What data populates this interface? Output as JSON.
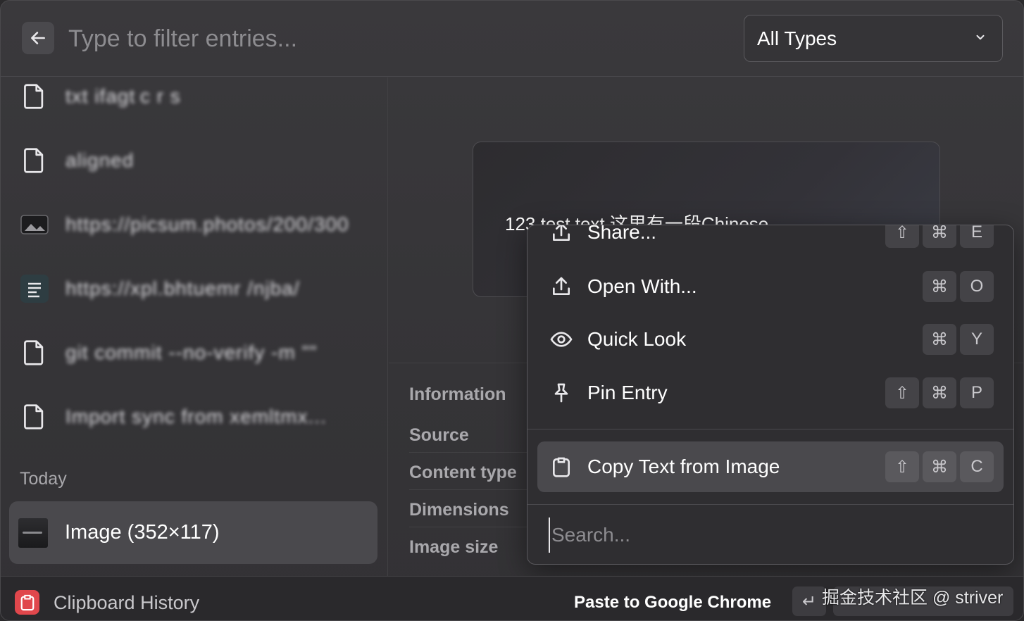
{
  "search": {
    "placeholder": "Type to filter entries..."
  },
  "type_filter": {
    "selected": "All Types"
  },
  "history": {
    "items": [
      {
        "icon": "document-icon",
        "label": "txt ifagt c r s"
      },
      {
        "icon": "document-icon",
        "label": "aligned"
      },
      {
        "icon": "image-icon",
        "label": "https://picsum.photos/200/300"
      },
      {
        "icon": "link-icon",
        "label": "https://xpl.bhtuemr /njba/"
      },
      {
        "icon": "document-icon",
        "label": "git commit --no-verify -m \"\""
      },
      {
        "icon": "document-icon",
        "label": "Import sync from xemltmx..."
      }
    ],
    "section_label": "Today",
    "selected": {
      "label": "Image (352×117)"
    }
  },
  "preview": {
    "text": "123 test text 这里有一段Chinese"
  },
  "information": {
    "title": "Information",
    "rows": [
      "Source",
      "Content type",
      "Dimensions",
      "Image size"
    ]
  },
  "action_menu": {
    "items": [
      {
        "icon": "share-icon",
        "label": "Share...",
        "keys": [
          "⇧",
          "⌘",
          "E"
        ]
      },
      {
        "icon": "upload-icon",
        "label": "Open With...",
        "keys": [
          "⌘",
          "O"
        ]
      },
      {
        "icon": "eye-icon",
        "label": "Quick Look",
        "keys": [
          "⌘",
          "Y"
        ]
      },
      {
        "icon": "pin-icon",
        "label": "Pin Entry",
        "keys": [
          "⇧",
          "⌘",
          "P"
        ]
      },
      {
        "icon": "clipboard-icon",
        "label": "Copy Text from Image",
        "keys": [
          "⇧",
          "⌘",
          "C"
        ]
      }
    ],
    "search_placeholder": "Search..."
  },
  "footer": {
    "app_name": "Clipboard History",
    "primary_action": "Paste to Google Chrome",
    "return_key": "↵",
    "watermark": "掘金技术社区 @ striver"
  },
  "colors": {
    "accent": "#e0474c",
    "selection": "#4a494d",
    "background": "#353437"
  }
}
